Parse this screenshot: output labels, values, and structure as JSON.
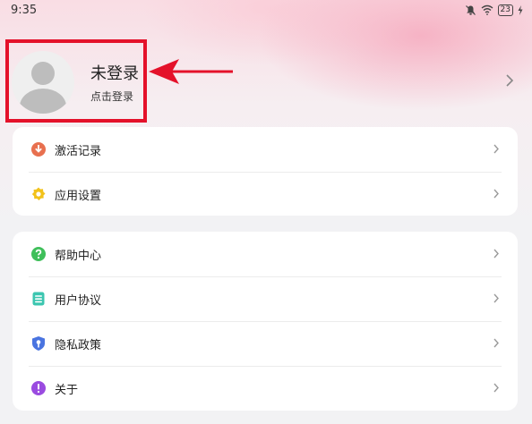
{
  "status_bar": {
    "time": "9:35",
    "battery": "23",
    "icons": [
      "mute-bell-icon",
      "wifi-icon",
      "battery-icon",
      "charging-icon"
    ]
  },
  "profile": {
    "title": "未登录",
    "subtitle": "点击登录",
    "highlight_color": "#e4112a"
  },
  "menu_group_1": {
    "items": [
      {
        "label": "激活记录",
        "icon": "download-circle-icon",
        "icon_color": "#e8704f"
      },
      {
        "label": "应用设置",
        "icon": "settings-gear-icon",
        "icon_color": "#f2c21b"
      }
    ]
  },
  "menu_group_2": {
    "items": [
      {
        "label": "帮助中心",
        "icon": "help-circle-icon",
        "icon_color": "#3fbf5a"
      },
      {
        "label": "用户协议",
        "icon": "document-icon",
        "icon_color": "#3cc6b0"
      },
      {
        "label": "隐私政策",
        "icon": "privacy-shield-icon",
        "icon_color": "#4a74e0"
      },
      {
        "label": "关于",
        "icon": "info-circle-icon",
        "icon_color": "#9a4be0"
      }
    ]
  }
}
